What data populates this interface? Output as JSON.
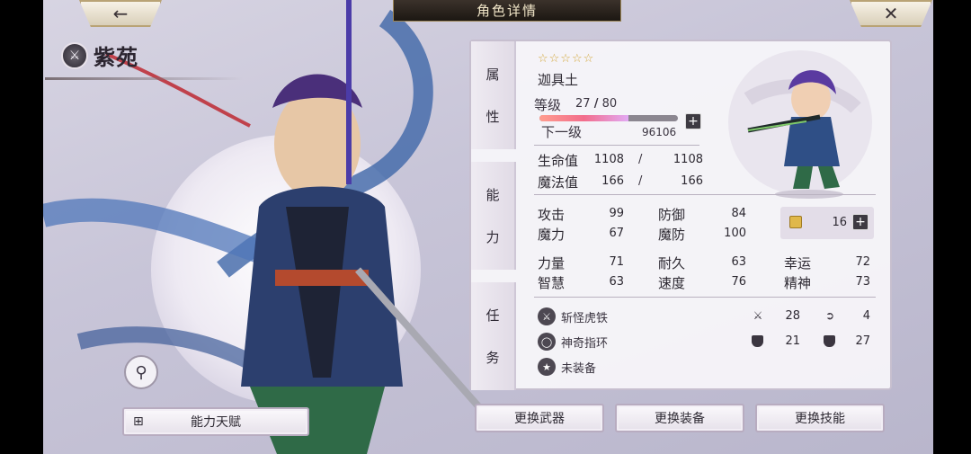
{
  "header": {
    "title": "角色详情",
    "back_icon": "arrow-left-icon",
    "close_icon": "close-icon"
  },
  "character": {
    "name": "紫苑",
    "weapon_type_icon": "sword-icon"
  },
  "left_controls": {
    "talent_button": "能力天赋",
    "zoom_icon": "magnifier-icon"
  },
  "tabs": {
    "attributes": [
      "属",
      "性"
    ],
    "ability": [
      "能",
      "力"
    ],
    "mission": [
      "任",
      "务"
    ]
  },
  "profile": {
    "stars": "☆☆☆☆☆",
    "rarity_stars": 5,
    "class": "迦具土",
    "level_label": "等级",
    "level": "27",
    "level_max": "80",
    "level_fraction": 0.64,
    "next_label": "下一级",
    "next_exp": "96106"
  },
  "vitals": {
    "hp_label": "生命值",
    "hp": "1108",
    "hp_max": "1108",
    "mp_label": "魔法值",
    "mp": "166",
    "mp_max": "166",
    "slash": "/"
  },
  "combat": {
    "atk_label": "攻击",
    "atk": "99",
    "def_label": "防御",
    "def": "84",
    "mag_label": "魔力",
    "mag": "67",
    "mdef_label": "魔防",
    "mdef": "100",
    "gem_count": "16"
  },
  "base": {
    "str_label": "力量",
    "str": "71",
    "end_label": "耐久",
    "end": "63",
    "luck_label": "幸运",
    "luck": "72",
    "wis_label": "智慧",
    "wis": "63",
    "spd_label": "速度",
    "spd": "76",
    "spirit_label": "精神",
    "spirit": "73"
  },
  "equipment": {
    "weapon": "斩怪虎铁",
    "weapon_atk": "28",
    "weapon_crit": "4",
    "accessory": "神奇指环",
    "accessory_def": "21",
    "accessory_res": "27",
    "empty": "未装备"
  },
  "actions": {
    "change_weapon": "更换武器",
    "change_equip": "更换装备",
    "change_skill": "更换技能"
  },
  "colors": {
    "panel_bg": "#f8f6fa",
    "accent_gold": "#d3a83c",
    "xp_fill": "#f26d8c"
  }
}
